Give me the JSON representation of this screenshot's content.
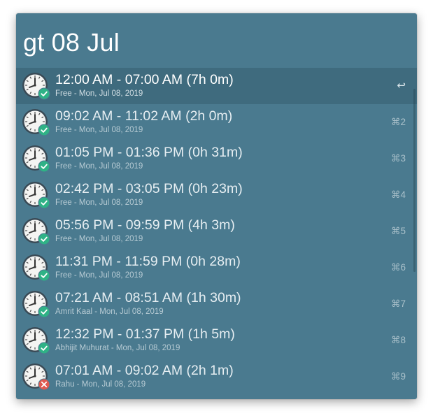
{
  "query": "gt 08 Jul",
  "colors": {
    "window_bg": "#4a7a8f",
    "selected_bg": "#3f6b7e",
    "badge_ok": "#2fb286",
    "badge_error": "#e05a50"
  },
  "results": [
    {
      "title": "12:00 AM - 07:00 AM (7h 0m)",
      "subtitle": "Free - Mon, Jul 08, 2019",
      "shortcut": "↩",
      "badge": "check",
      "selected": true
    },
    {
      "title": "09:02 AM - 11:02 AM (2h 0m)",
      "subtitle": "Free - Mon, Jul 08, 2019",
      "shortcut": "⌘2",
      "badge": "check"
    },
    {
      "title": "01:05 PM - 01:36 PM (0h 31m)",
      "subtitle": "Free - Mon, Jul 08, 2019",
      "shortcut": "⌘3",
      "badge": "check"
    },
    {
      "title": "02:42 PM - 03:05 PM (0h 23m)",
      "subtitle": "Free - Mon, Jul 08, 2019",
      "shortcut": "⌘4",
      "badge": "check"
    },
    {
      "title": "05:56 PM - 09:59 PM (4h 3m)",
      "subtitle": "Free - Mon, Jul 08, 2019",
      "shortcut": "⌘5",
      "badge": "check"
    },
    {
      "title": "11:31 PM - 11:59 PM (0h 28m)",
      "subtitle": "Free - Mon, Jul 08, 2019",
      "shortcut": "⌘6",
      "badge": "check"
    },
    {
      "title": "07:21 AM - 08:51 AM (1h 30m)",
      "subtitle": "Amrit Kaal - Mon, Jul 08, 2019",
      "shortcut": "⌘7",
      "badge": "check"
    },
    {
      "title": "12:32 PM - 01:37 PM (1h 5m)",
      "subtitle": "Abhijit Muhurat - Mon, Jul 08, 2019",
      "shortcut": "⌘8",
      "badge": "check"
    },
    {
      "title": "07:01 AM - 09:02 AM (2h 1m)",
      "subtitle": "Rahu - Mon, Jul 08, 2019",
      "shortcut": "⌘9",
      "badge": "cross"
    }
  ]
}
